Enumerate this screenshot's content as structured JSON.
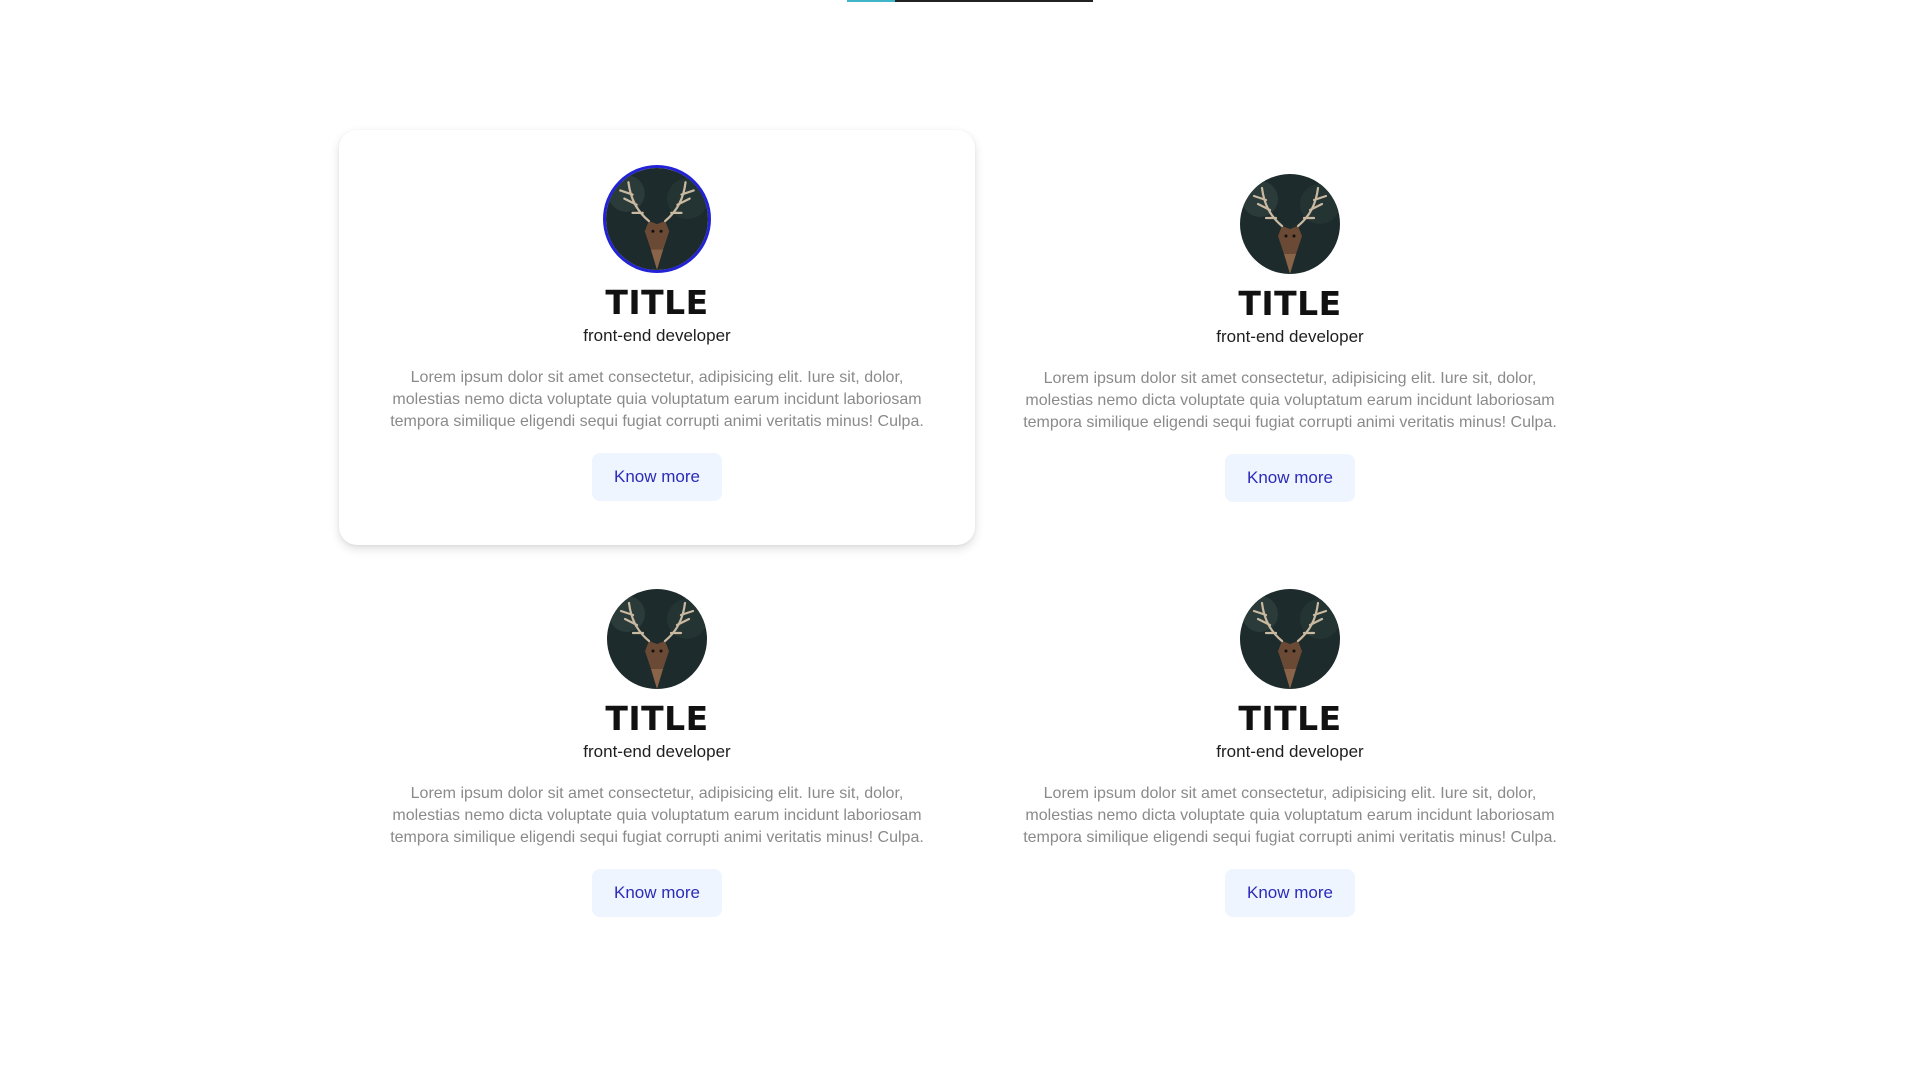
{
  "cards": [
    {
      "title": "TITLE",
      "subtitle": "front-end developer",
      "description": "Lorem ipsum dolor sit amet consectetur, adipisicing elit. Iure sit, dolor, molestias nemo dicta voluptate quia voluptatum earum incidunt laboriosam tempora similique eligendi sequi fugiat corrupti animi veritatis minus! Culpa.",
      "button": "Know more"
    },
    {
      "title": "TITLE",
      "subtitle": "front-end developer",
      "description": "Lorem ipsum dolor sit amet consectetur, adipisicing elit. Iure sit, dolor, molestias nemo dicta voluptate quia voluptatum earum incidunt laboriosam tempora similique eligendi sequi fugiat corrupti animi veritatis minus! Culpa.",
      "button": "Know more"
    },
    {
      "title": "TITLE",
      "subtitle": "front-end developer",
      "description": "Lorem ipsum dolor sit amet consectetur, adipisicing elit. Iure sit, dolor, molestias nemo dicta voluptate quia voluptatum earum incidunt laboriosam tempora similique eligendi sequi fugiat corrupti animi veritatis minus! Culpa.",
      "button": "Know more"
    },
    {
      "title": "TITLE",
      "subtitle": "front-end developer",
      "description": "Lorem ipsum dolor sit amet consectetur, adipisicing elit. Iure sit, dolor, molestias nemo dicta voluptate quia voluptatum earum incidunt laboriosam tempora similique eligendi sequi fugiat corrupti animi veritatis minus! Culpa.",
      "button": "Know more"
    }
  ],
  "colors": {
    "accent": "#2323d6",
    "button_bg": "#eef5ff",
    "button_text": "#2b2bb8",
    "description_text": "#8a8a8a",
    "top_line_accent": "#3fb6c8"
  },
  "icons": {
    "avatar": "deer-portrait-image"
  }
}
